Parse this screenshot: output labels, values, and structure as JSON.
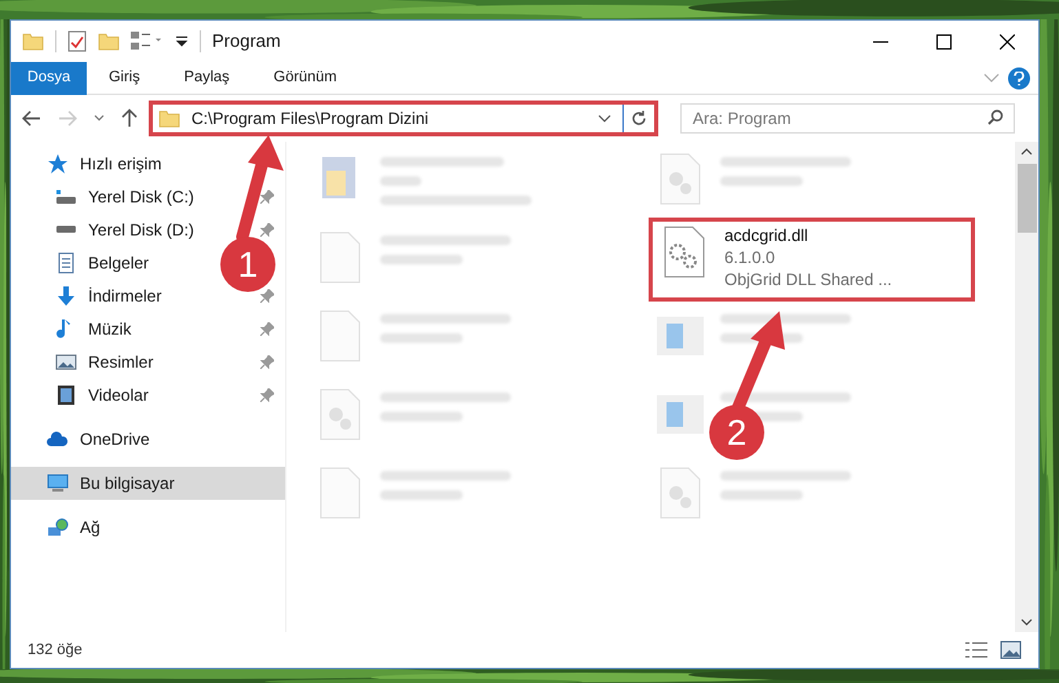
{
  "window": {
    "title": "Program"
  },
  "ribbon_tabs": [
    {
      "label": "Dosya",
      "selected": true
    },
    {
      "label": "Giriş",
      "selected": false
    },
    {
      "label": "Paylaş",
      "selected": false
    },
    {
      "label": "Görünüm",
      "selected": false
    }
  ],
  "address": {
    "path": "C:\\Program Files\\Program Dizini"
  },
  "search": {
    "placeholder": "Ara: Program"
  },
  "sidebar": {
    "items": [
      {
        "label": "Hızlı erişim",
        "kind": "quick",
        "selected": false,
        "pinned": false,
        "children": [
          {
            "label": "Yerel Disk (C:)",
            "kind": "sysdrive",
            "selected": false,
            "pinned": true
          },
          {
            "label": "Yerel Disk (D:)",
            "kind": "drive",
            "selected": false,
            "pinned": true
          },
          {
            "label": "Belgeler",
            "kind": "documents",
            "selected": false
          },
          {
            "label": "İndirmeler",
            "kind": "downloads",
            "selected": false,
            "pinned": true
          },
          {
            "label": "Müzik",
            "kind": "music",
            "selected": false,
            "pinned": true
          },
          {
            "label": "Resimler",
            "kind": "pictures",
            "selected": false,
            "pinned": true
          },
          {
            "label": "Videolar",
            "kind": "videos",
            "selected": false,
            "pinned": true
          }
        ]
      },
      {
        "label": "OneDrive",
        "kind": "cloud",
        "selected": false,
        "pinned": false
      },
      {
        "label": "Bu bilgisayar",
        "kind": "computer",
        "selected": true,
        "pinned": false
      },
      {
        "label": "Ağ",
        "kind": "network",
        "selected": false,
        "pinned": false
      }
    ]
  },
  "files": [
    {
      "kind": "exe",
      "blurred": true,
      "highlighted": false
    },
    {
      "kind": "dll",
      "blurred": true,
      "highlighted": false
    },
    {
      "kind": "blank",
      "blurred": true,
      "highlighted": false
    },
    {
      "name": "acdcgrid.dll",
      "details": [
        "6.1.0.0",
        "ObjGrid DLL Shared ..."
      ],
      "kind": "gears",
      "blurred": false,
      "highlighted": true
    },
    {
      "kind": "blank",
      "blurred": true,
      "highlighted": false
    },
    {
      "kind": "app",
      "blurred": true,
      "highlighted": false
    },
    {
      "kind": "dll",
      "blurred": true,
      "highlighted": false
    },
    {
      "kind": "app",
      "blurred": true,
      "highlighted": false
    },
    {
      "kind": "blank",
      "blurred": true,
      "highlighted": false
    },
    {
      "kind": "dll",
      "blurred": true,
      "highlighted": false
    }
  ],
  "status_bar": {
    "count": "132 öğe"
  },
  "annotations": [
    {
      "number": "1"
    },
    {
      "number": "2"
    }
  ]
}
